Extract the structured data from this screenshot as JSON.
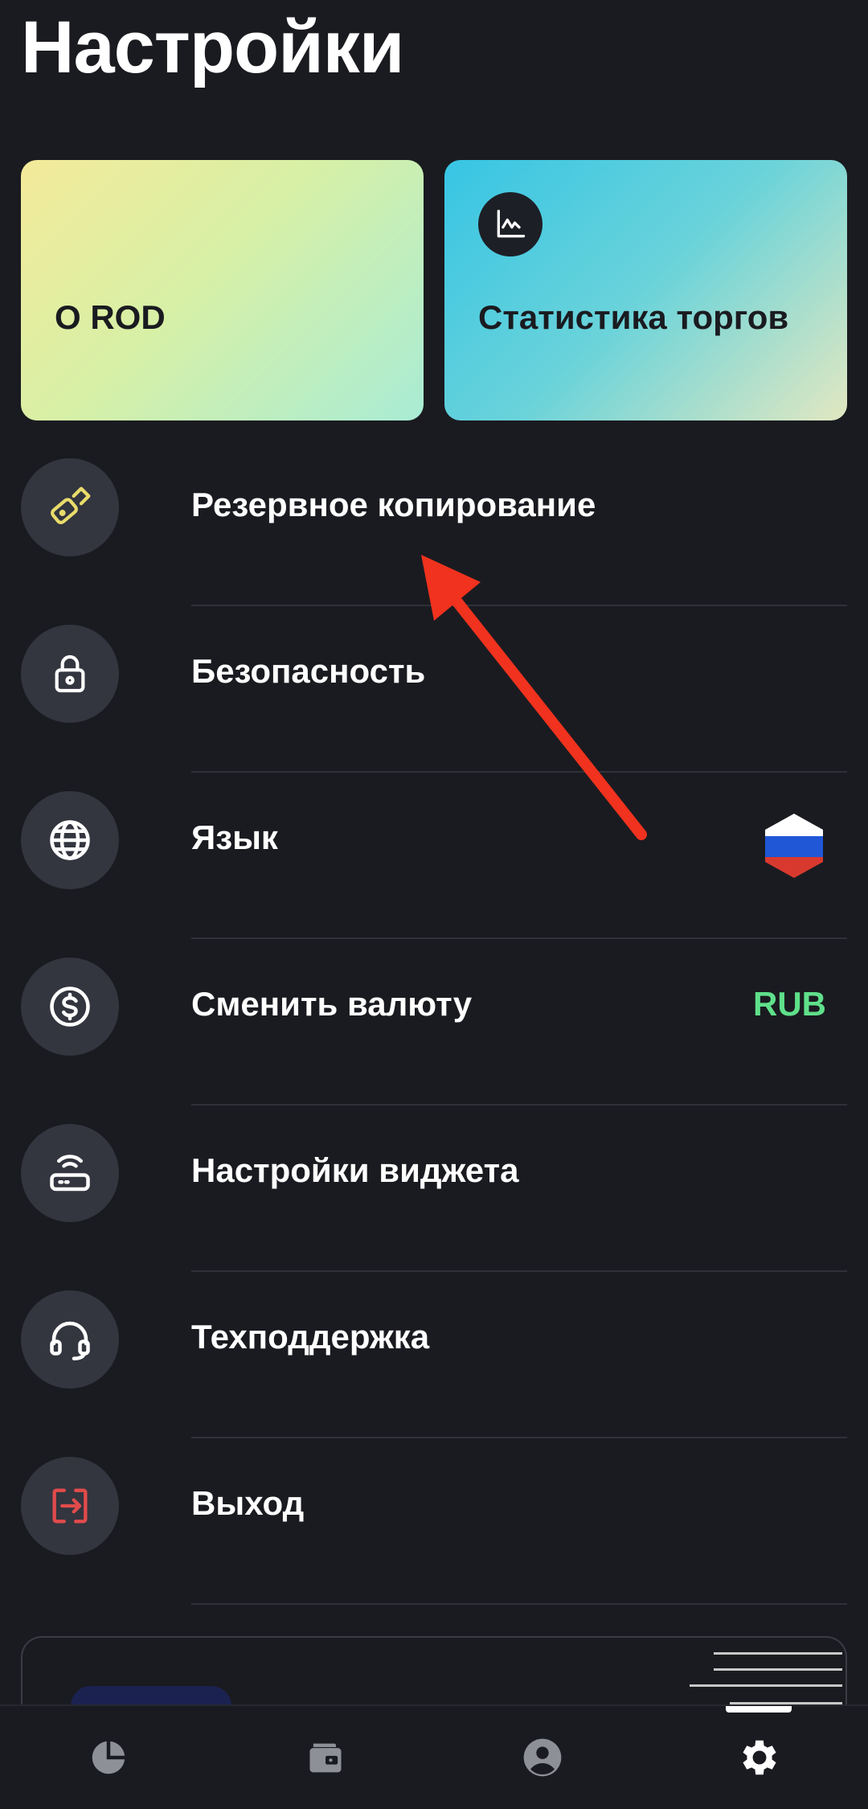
{
  "header": {
    "title": "Настройки"
  },
  "cards": [
    {
      "label": "О ROD"
    },
    {
      "label": "Статистика торгов",
      "icon": "chart-icon"
    }
  ],
  "settings": [
    {
      "label": "Резервное копирование",
      "icon": "usb-drive-icon",
      "icon_color": "#e9dc6b"
    },
    {
      "label": "Безопасность",
      "icon": "lock-icon"
    },
    {
      "label": "Язык",
      "icon": "globe-icon",
      "flag": "russian-flag-icon"
    },
    {
      "label": "Сменить валюту",
      "icon": "dollar-icon",
      "value": "RUB",
      "value_color": "#5fe08a"
    },
    {
      "label": "Настройки виджета",
      "icon": "router-icon"
    },
    {
      "label": "Техподдержка",
      "icon": "headset-icon"
    },
    {
      "label": "Выход",
      "icon": "logout-icon",
      "icon_color": "#e14b4b"
    }
  ],
  "bottom_nav": [
    {
      "icon": "pie-chart-icon",
      "active": false
    },
    {
      "icon": "wallet-icon",
      "active": false
    },
    {
      "icon": "profile-icon",
      "active": false
    },
    {
      "icon": "settings-gear-icon",
      "active": true
    }
  ],
  "colors": {
    "background": "#1a1b20",
    "accent_green": "#5fe08a",
    "annotation_arrow": "#f0321e"
  }
}
